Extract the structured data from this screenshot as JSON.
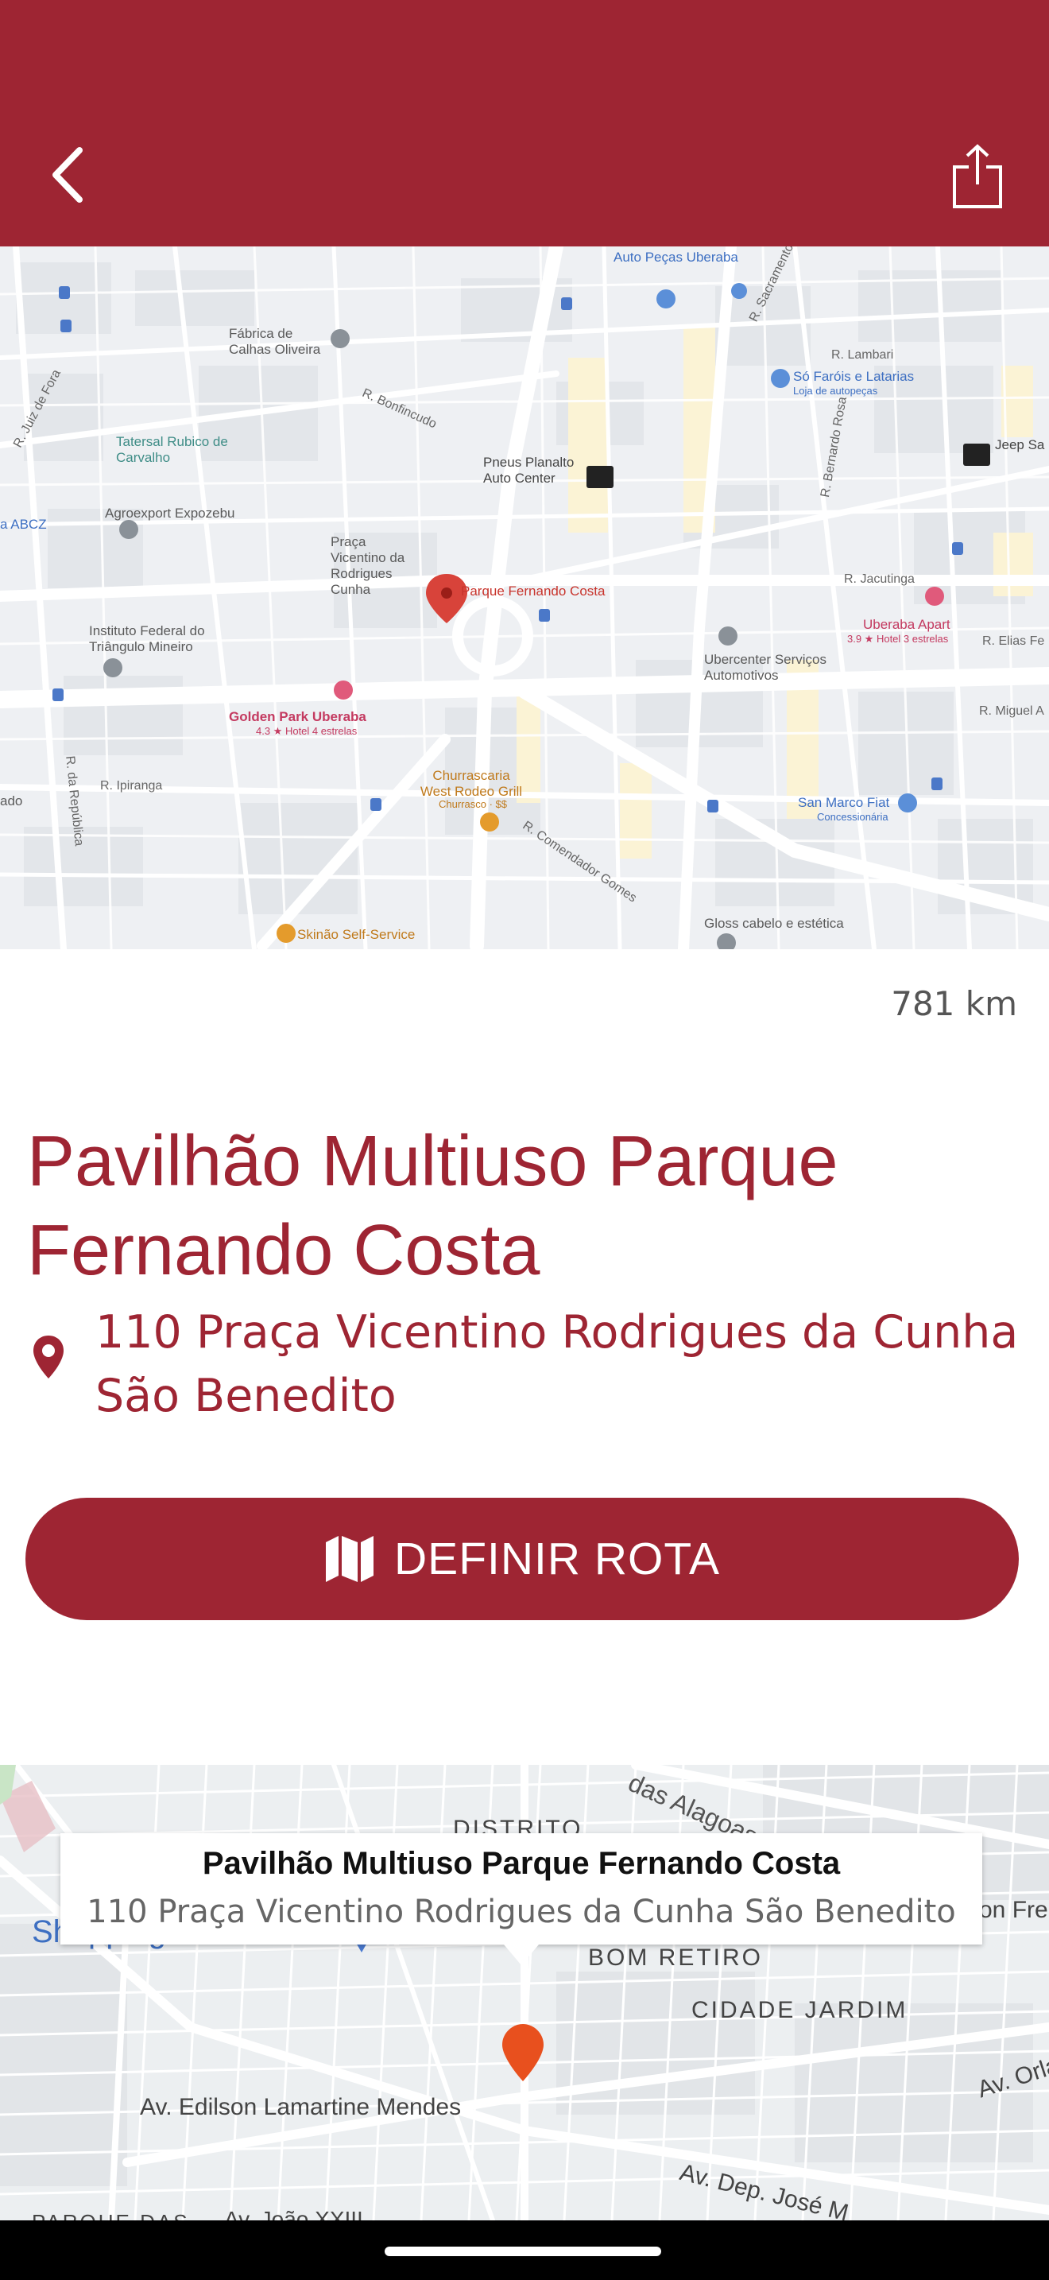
{
  "header": {
    "back_icon": "chevron-left-icon",
    "share_icon": "share-icon",
    "background_color": "#9e2533"
  },
  "map_top": {
    "labels": [
      "Fábrica de Calhas Oliveira",
      "Tatersal Rubico de Carvalho",
      "Agroexport Expozebu",
      "Praça Vicentino da Rodrigues Cunha",
      "Parque Fernando Costa",
      "Pneus Planalto Auto Center",
      "Instituto Federal do Triângulo Mineiro",
      "Golden Park Uberaba",
      "4.3 ★ Hotel 4 estrelas",
      "Churrascaria West Rodeo Grill",
      "Churrasco · $$",
      "Ubercenter Serviços Automotivos",
      "Só Faróis e Latarias",
      "Loja de autopeças",
      "Uberaba Apart",
      "3.9 ★ Hotel 3 estrelas",
      "San Marco Fiat",
      "Concessionária",
      "Gloss cabelo e estética",
      "Skinão Self-Service",
      "Jeep Sa",
      "Auto Peças Uberaba",
      "R. Lambari",
      "R. Jacutinga",
      "R. Elias Fe",
      "R. Miguel A",
      "R. Ipiranga",
      "R. Comendador Gomes",
      "R. Bonfincudo",
      "R. Juiz de Fora",
      "R. da República",
      "R. Sacramento",
      "R. Bernardo Rosa",
      "a ABCZ",
      "ado"
    ]
  },
  "distance": "781 km",
  "venue": {
    "title": "Pavilhão Multiuso Parque Fernando Costa",
    "address_line1": "110 Praça Vicentino Rodrigues da Cunha",
    "address_line2": "São Benedito",
    "pin_icon": "location-pin-icon"
  },
  "route_button": {
    "label": "DEFINIR ROTA",
    "icon": "map-icon"
  },
  "map_bottom": {
    "info_title": "Pavilhão Multiuso Parque Fernando Costa",
    "info_address": "110 Praça Vicentino Rodrigues da Cunha São Benedito",
    "labels": [
      "das Alagoas",
      "DISTRITO",
      "Shopping Uberaba",
      "BOM RETIRO",
      "CIDADE JARDIM",
      "Av. Edilson Lamartine Mendes",
      "Av. Orla",
      "Av. Dep. José M",
      "Av. João XXIII",
      "PARQUE DAS",
      "on Fre"
    ]
  }
}
